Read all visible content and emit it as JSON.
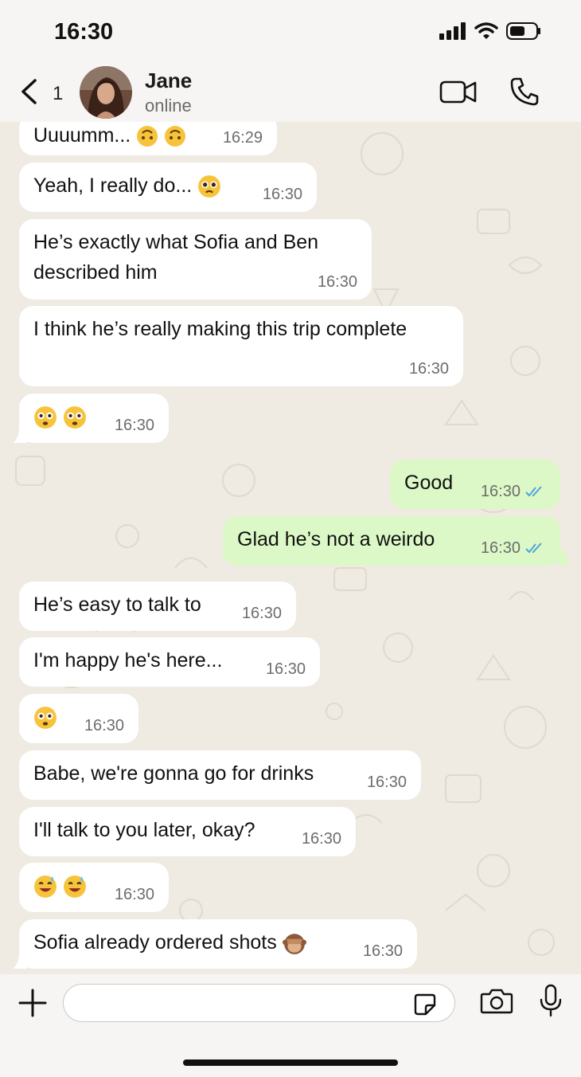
{
  "status": {
    "time": "16:30"
  },
  "header": {
    "unread_count": "1",
    "name": "Jane",
    "presence": "online"
  },
  "messages": [
    {
      "text": "Uuuumm...",
      "time": "16:29"
    },
    {
      "text": "Yeah, I really do...",
      "time": "16:30"
    },
    {
      "text": "He’s exactly what Sofia and Ben",
      "text2": "described him",
      "time": "16:30"
    },
    {
      "text": "I think he’s really making this trip complete",
      "time": "16:30"
    },
    {
      "time": "16:30"
    },
    {
      "text": "Good",
      "time": "16:30"
    },
    {
      "text": "Glad he’s not a weirdo",
      "time": "16:30"
    },
    {
      "text": "He’s easy to talk to",
      "time": "16:30"
    },
    {
      "text": "I'm happy he's here...",
      "time": "16:30"
    },
    {
      "time": "16:30"
    },
    {
      "text": "Babe, we're gonna go for drinks",
      "time": "16:30"
    },
    {
      "text": "I'll talk to you later, okay?",
      "time": "16:30"
    },
    {
      "time": "16:30"
    },
    {
      "text": "Sofia already ordered shots",
      "time": "16:30"
    }
  ],
  "composer": {
    "value": ""
  },
  "colors": {
    "incoming": "#ffffff",
    "outgoing": "#dcf8c6",
    "read_ticks": "#4fa3e0"
  }
}
